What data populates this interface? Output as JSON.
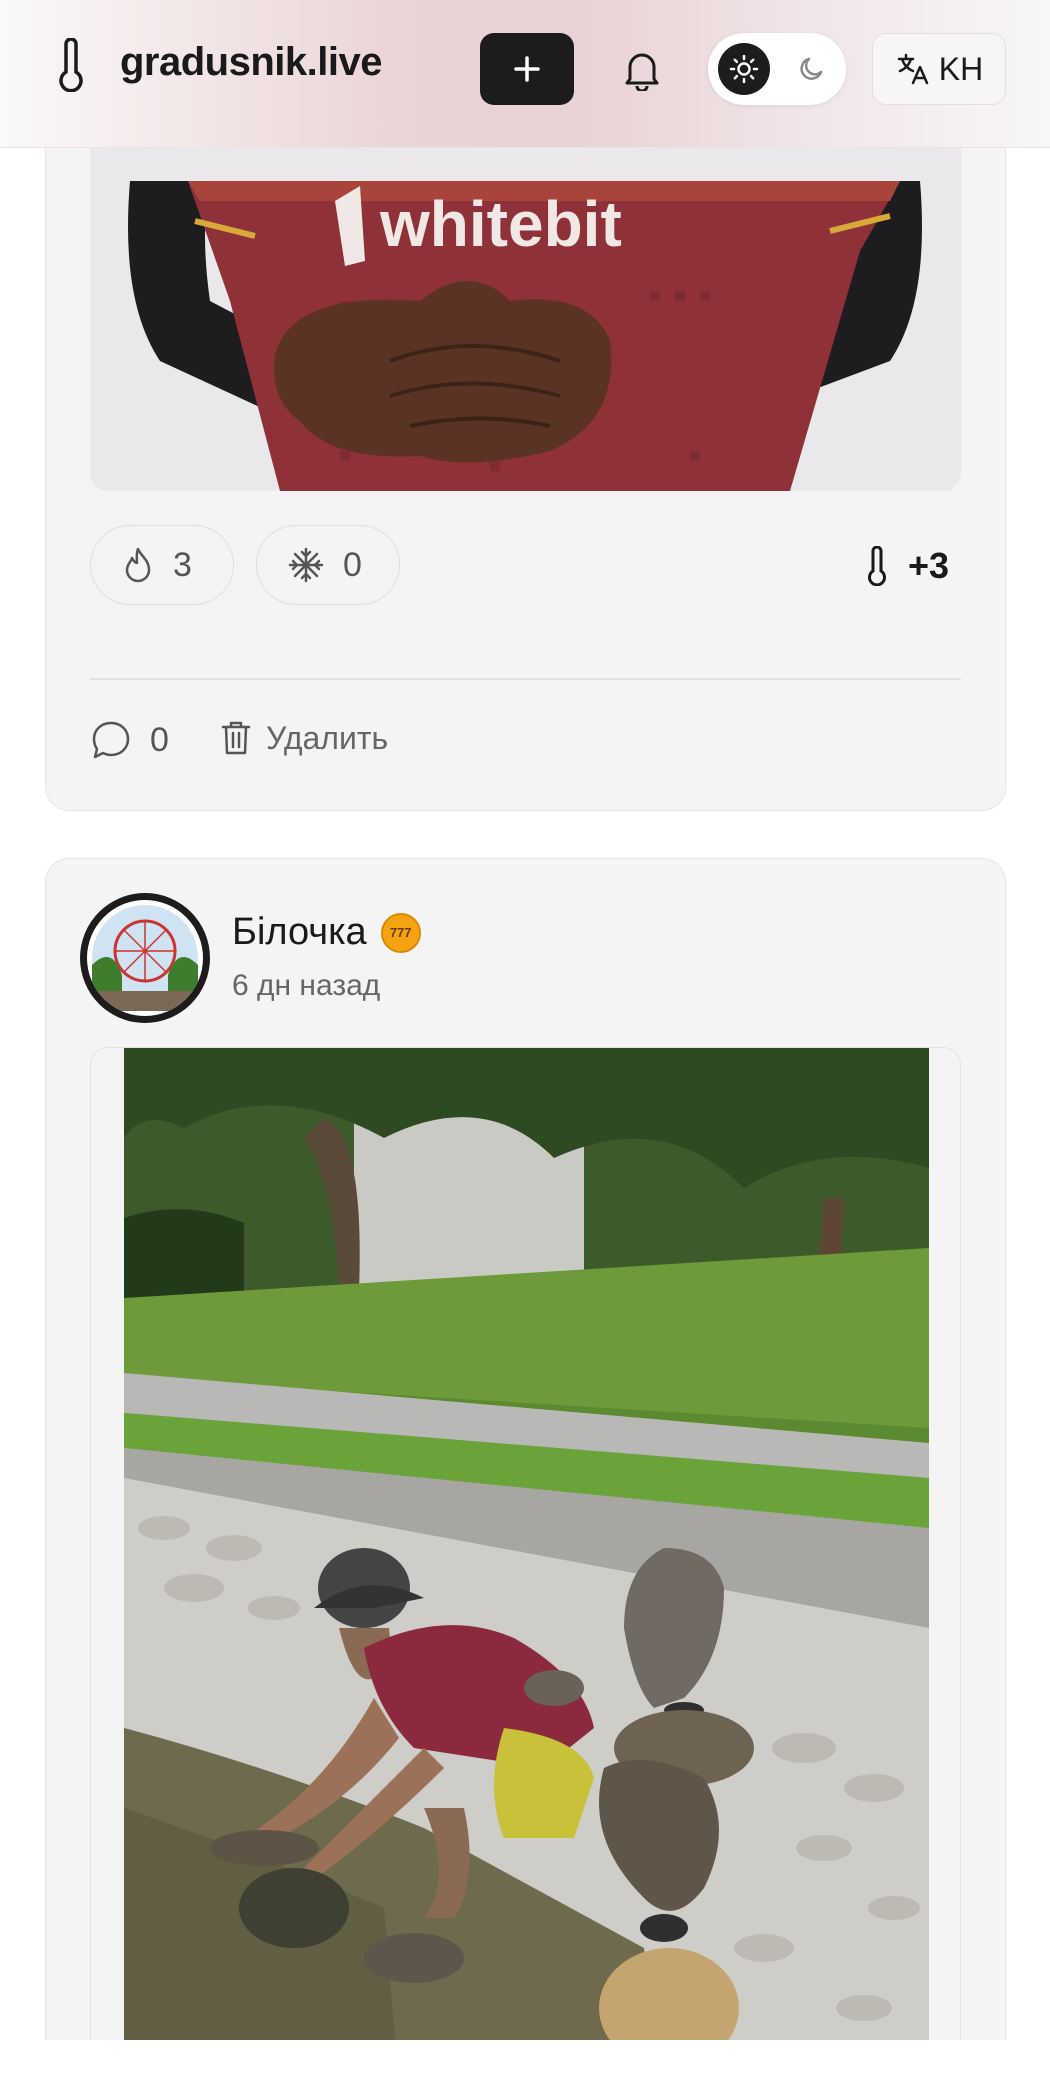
{
  "header": {
    "logo_text": "gradusnik.live",
    "lang_label": "KH",
    "icons": [
      "thermometer-icon",
      "plus-icon",
      "bell-icon",
      "sun-icon",
      "moon-icon",
      "translate-icon"
    ]
  },
  "post1": {
    "image_alt": "Player in whitebit kit",
    "jersey_text": "whitebit",
    "fire_count": "3",
    "frost_count": "0",
    "temperature": "+3",
    "comments_count": "0",
    "delete_label": "Удалить"
  },
  "post2": {
    "author_name": "Білочка",
    "badge_text": "777",
    "time_ago": "6 дн назад",
    "image_alt": "Man balancing stones in a stream"
  },
  "colors": {
    "accent_dark": "#1c1c1c",
    "card_bg": "#f4f4f4",
    "badge_orange": "#f6a313"
  }
}
